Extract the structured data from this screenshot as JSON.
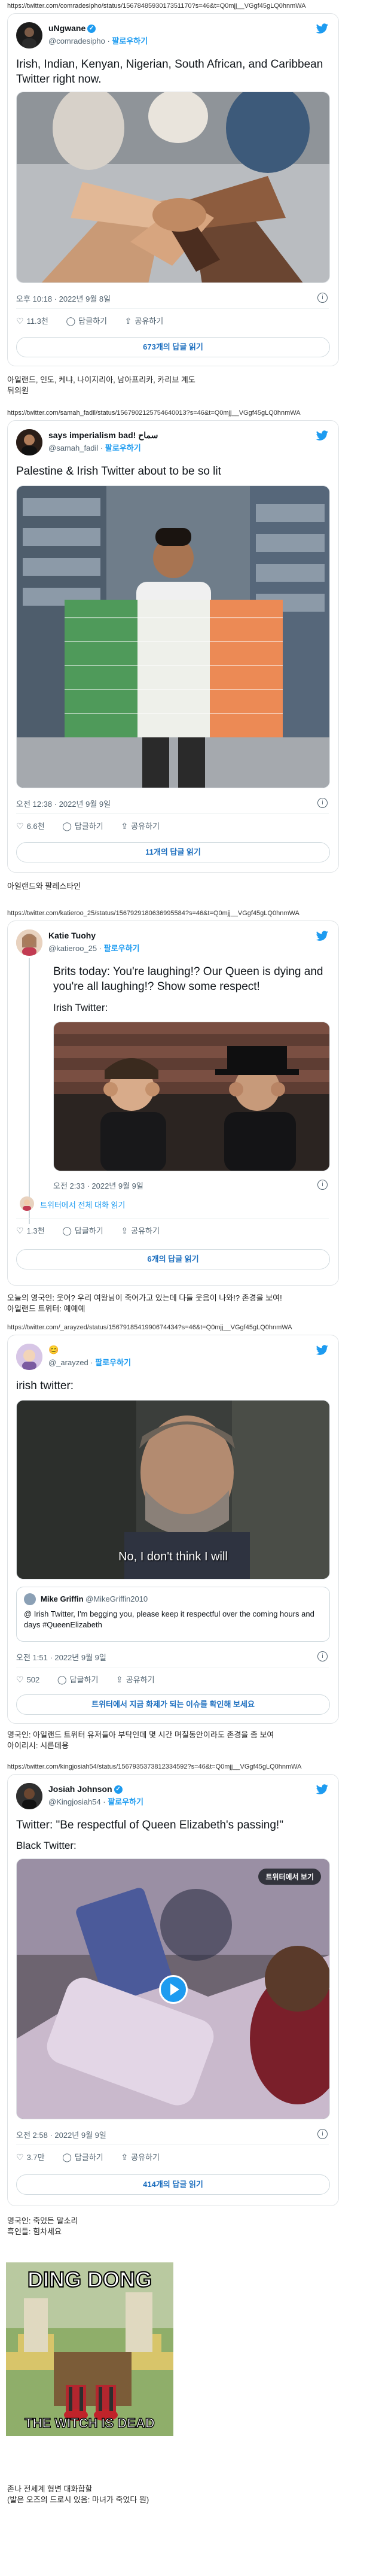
{
  "tweets": [
    {
      "url": "https://twitter.com/comradesipho/status/1567848593017351170?s=46&t=Q0mjj__VGgf45gLQ0hnmWA",
      "author": "uNgwane",
      "handle": "@comradesipho",
      "follow": "팔로우하기",
      "text": "Irish, Indian, Kenyan, Nigerian, South African, and Caribbean Twitter right now.",
      "time": "오후 10:18 · 2022년 9월 8일",
      "likes": "11.3천",
      "reply_label": "답글하기",
      "share_label": "공유하기",
      "read_replies": "673개의 답글 읽기",
      "caption": "아일랜드, 인도, 케냐, 나이지리아, 남아프리카, 카리브 계도\n뒤의원"
    },
    {
      "url": "https://twitter.com/samah_fadil/status/1567902125754640013?s=46&t=Q0mjj__VGgf45gLQ0hnmWA",
      "author": "says imperialism bad! سماح",
      "handle": "@samah_fadil",
      "follow": "팔로우하기",
      "text": "Palestine & Irish Twitter about to be so lit",
      "time": "오전 12:38 · 2022년 9월 9일",
      "likes": "6.6천",
      "reply_label": "답글하기",
      "share_label": "공유하기",
      "read_replies": "11개의 답글 읽기",
      "caption": "아일랜드와 팔레스타인"
    },
    {
      "url": "https://twitter.com/katieroo_25/status/1567929180636995584?s=46&t=Q0mjj__VGgf45gLQ0hnmWA",
      "author": "Katie Tuohy",
      "handle": "@katieroo_25",
      "follow": "팔로우하기",
      "text": "Brits today: You're laughing!? Our Queen is dying and you're all laughing!? Show some respect!",
      "text2": "Irish Twitter:",
      "time": "오전 2:33 · 2022년 9월 9일",
      "reply_row": "트위터에서 전체 대화 읽기",
      "likes": "1.3천",
      "reply_label": "답글하기",
      "share_label": "공유하기",
      "read_replies": "6개의 답글 읽기",
      "caption": "오늘의 영국인: 웃어? 우리 여왕님이 죽어가고 있는데 다들 웃음이 나와!? 존경을 보여!\n아일랜드 트위터: 예예예"
    },
    {
      "url": "https://twitter.com/_arayzed/status/1567918541990674434?s=46&t=Q0mjj__VGgf45gLQ0hnmWA",
      "author": "😊",
      "handle": "@_arayzed",
      "follow": "팔로우하기",
      "text": "irish twitter:",
      "image_caption": "No, I don't think I will",
      "quote_author": "Mike Griffin",
      "quote_handle": "@MikeGriffin2010",
      "quote_text": "@ Irish Twitter, I'm begging you, please keep it respectful over the coming hours and days #QueenElizabeth",
      "time": "오전 1:51 · 2022년 9월 9일",
      "likes": "502",
      "reply_label": "답글하기",
      "share_label": "공유하기",
      "read_replies": "트위터에서 지금 화제가 되는 이슈를 확인해 보세요",
      "caption": "영국인: 아일랜드 트위터 유저들아 부탁인데 몇 시간 며칠동안이라도 존경을 좀 보여\n아이리시: 시른데용"
    },
    {
      "url": "https://twitter.com/kingjosiah54/status/1567935373812334592?s=46&t=Q0mjj__VGgf45gLQ0hnmWA",
      "author": "Josiah Johnson",
      "handle": "@Kingjosiah54",
      "follow": "팔로우하기",
      "text": "Twitter: \"Be respectful of Queen Elizabeth's passing!\"",
      "text2": "Black Twitter:",
      "video_button": "트위터에서 보기",
      "time": "오전 2:58 · 2022년 9월 9일",
      "likes": "3.7만",
      "reply_label": "답글하기",
      "share_label": "공유하기",
      "read_replies": "414개의 답글 읽기",
      "caption": "영국인: 죽었든 말소리\n흑인들: 힘차세요"
    }
  ],
  "meme": {
    "top": "DING DONG",
    "bottom": "THE WITCH IS DEAD"
  },
  "footer_caption": "존나 전세계 형변 대화합할\n(발은 오즈의 드로시 있음: 마녀가 죽었다 뭔)",
  "colors": {
    "accent": "#1d9bf0",
    "muted": "#536471"
  }
}
